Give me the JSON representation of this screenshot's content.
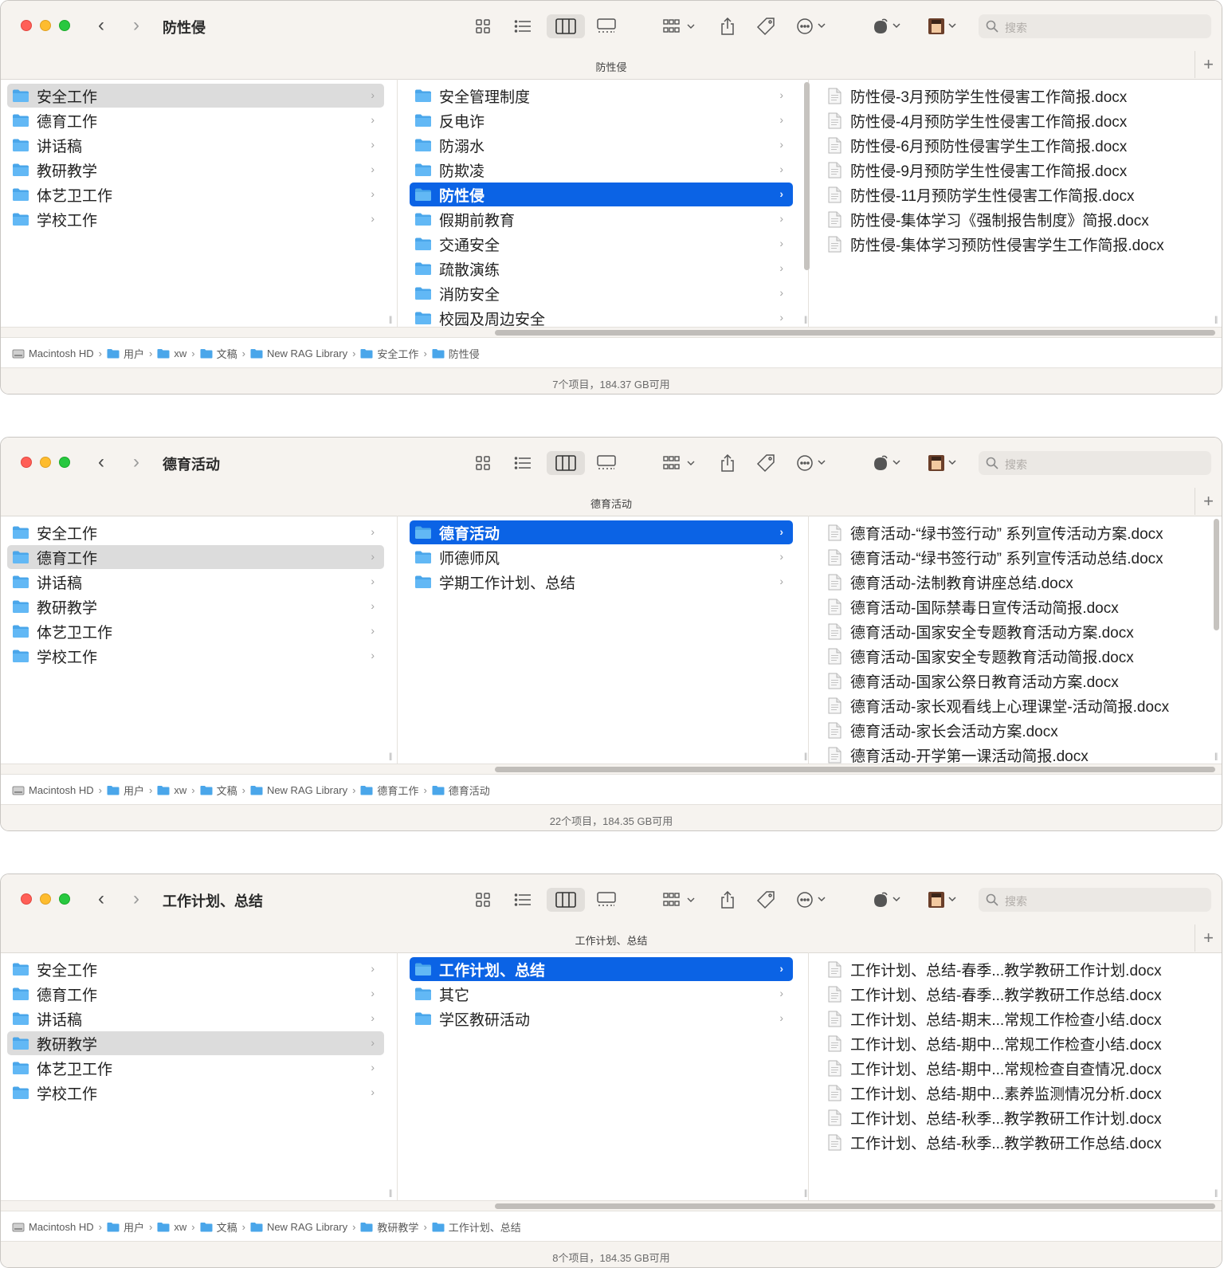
{
  "search_placeholder": "搜索",
  "windows": [
    {
      "title": "防性侵",
      "path_title": "防性侵",
      "col1": [
        "安全工作",
        "德育工作",
        "讲话稿",
        "教研教学",
        "体艺卫工作",
        "学校工作"
      ],
      "col1_selected": 0,
      "col2": [
        "安全管理制度",
        "反电诈",
        "防溺水",
        "防欺凌",
        "防性侵",
        "假期前教育",
        "交通安全",
        "疏散演练",
        "消防安全",
        "校园及周边安全"
      ],
      "col2_selected": 4,
      "files": [
        "防性侵-3月预防学生性侵害工作简报.docx",
        "防性侵-4月预防学生性侵害工作简报.docx",
        "防性侵-6月预防性侵害学生工作简报.docx",
        "防性侵-9月预防学生性侵害工作简报.docx",
        "防性侵-11月预防学生性侵害工作简报.docx",
        "防性侵-集体学习《强制报告制度》简报.docx",
        "防性侵-集体学习预防性侵害学生工作简报.docx"
      ],
      "breadcrumb": [
        "Macintosh HD",
        "用户",
        "xw",
        "文稿",
        "New RAG Library",
        "安全工作",
        "防性侵"
      ],
      "status": "7个项目，184.37 GB可用"
    },
    {
      "title": "德育活动",
      "path_title": "德育活动",
      "col1": [
        "安全工作",
        "德育工作",
        "讲话稿",
        "教研教学",
        "体艺卫工作",
        "学校工作"
      ],
      "col1_selected": 1,
      "col2": [
        "德育活动",
        "师德师风",
        "学期工作计划、总结"
      ],
      "col2_selected": 0,
      "files": [
        "德育活动-“绿书签行动” 系列宣传活动方案.docx",
        "德育活动-“绿书签行动” 系列宣传活动总结.docx",
        "德育活动-法制教育讲座总结.docx",
        "德育活动-国际禁毒日宣传活动简报.docx",
        "德育活动-国家安全专题教育活动方案.docx",
        "德育活动-国家安全专题教育活动简报.docx",
        "德育活动-国家公祭日教育活动方案.docx",
        "德育活动-家长观看线上心理课堂-活动简报.docx",
        "德育活动-家长会活动方案.docx",
        "德育活动-开学第一课活动简报.docx"
      ],
      "breadcrumb": [
        "Macintosh HD",
        "用户",
        "xw",
        "文稿",
        "New RAG Library",
        "德育工作",
        "德育活动"
      ],
      "status": "22个项目，184.35 GB可用"
    },
    {
      "title": "工作计划、总结",
      "path_title": "工作计划、总结",
      "col1": [
        "安全工作",
        "德育工作",
        "讲话稿",
        "教研教学",
        "体艺卫工作",
        "学校工作"
      ],
      "col1_selected": 3,
      "col2": [
        "工作计划、总结",
        "其它",
        "学区教研活动"
      ],
      "col2_selected": 0,
      "files": [
        "工作计划、总结-春季...教学教研工作计划.docx",
        "工作计划、总结-春季...教学教研工作总结.docx",
        "工作计划、总结-期末...常规工作检查小结.docx",
        "工作计划、总结-期中...常规工作检查小结.docx",
        "工作计划、总结-期中...常规检查自查情况.docx",
        "工作计划、总结-期中...素养监测情况分析.docx",
        "工作计划、总结-秋季...教学教研工作计划.docx",
        "工作计划、总结-秋季...教学教研工作总结.docx"
      ],
      "breadcrumb": [
        "Macintosh HD",
        "用户",
        "xw",
        "文稿",
        "New RAG Library",
        "教研教学",
        "工作计划、总结"
      ],
      "status": "8个项目，184.35 GB可用"
    }
  ]
}
